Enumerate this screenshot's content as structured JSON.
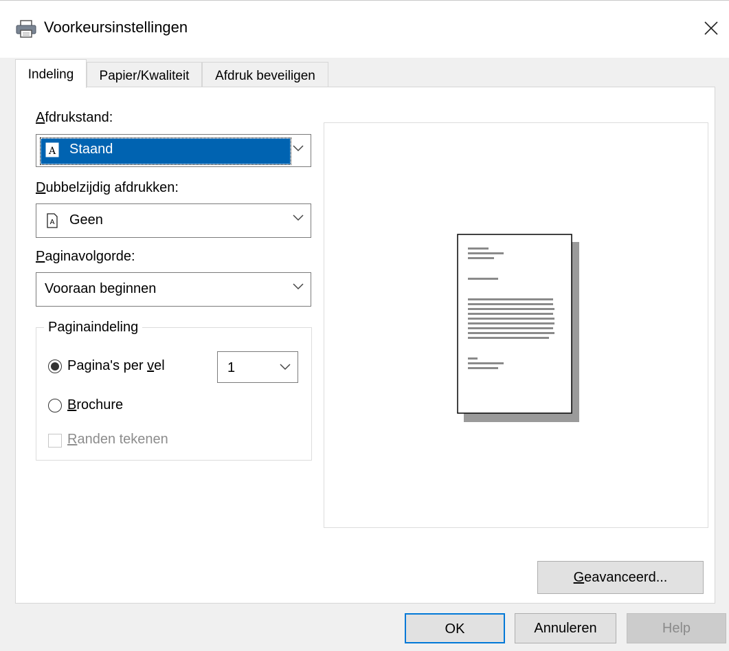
{
  "window": {
    "title": "Voorkeursinstellingen",
    "icon": "printer-icon",
    "close_icon": "close-icon"
  },
  "tabs": [
    {
      "label": "Indeling",
      "selected": true
    },
    {
      "label": "Papier/Kwaliteit",
      "selected": false
    },
    {
      "label": "Afdruk beveiligen",
      "selected": false
    }
  ],
  "layout_tab": {
    "orientation": {
      "label_first": "A",
      "label_rest": "fdrukstand:",
      "value": "Staand",
      "icon": "portrait-document-icon"
    },
    "duplex": {
      "label_first": "D",
      "label_rest": "ubbelzijdig afdrukken:",
      "value": "Geen",
      "icon": "single-sided-document-icon"
    },
    "page_order": {
      "label_first": "P",
      "label_rest": "aginavolgorde:",
      "value": "Vooraan beginnen"
    },
    "page_layout": {
      "legend": "Paginaindeling",
      "pages_per_sheet": {
        "label_before": "Pagina's per ",
        "label_underline": "v",
        "label_after": "el",
        "selected": true,
        "value": "1"
      },
      "brochure": {
        "label_underline": "B",
        "label_rest": "rochure",
        "selected": false
      },
      "draw_borders": {
        "label_underline": "R",
        "label_rest": "anden tekenen",
        "checked": false,
        "enabled": false
      }
    },
    "advanced_button": {
      "label_underline": "G",
      "label_rest": "eavanceerd..."
    }
  },
  "footer": {
    "ok_label": "OK",
    "cancel_label": "Annuleren",
    "help_label": "Help"
  },
  "colors": {
    "selection": "#0063b1",
    "ok_border": "#0078d7",
    "disabled_text": "#8c8c8c"
  }
}
